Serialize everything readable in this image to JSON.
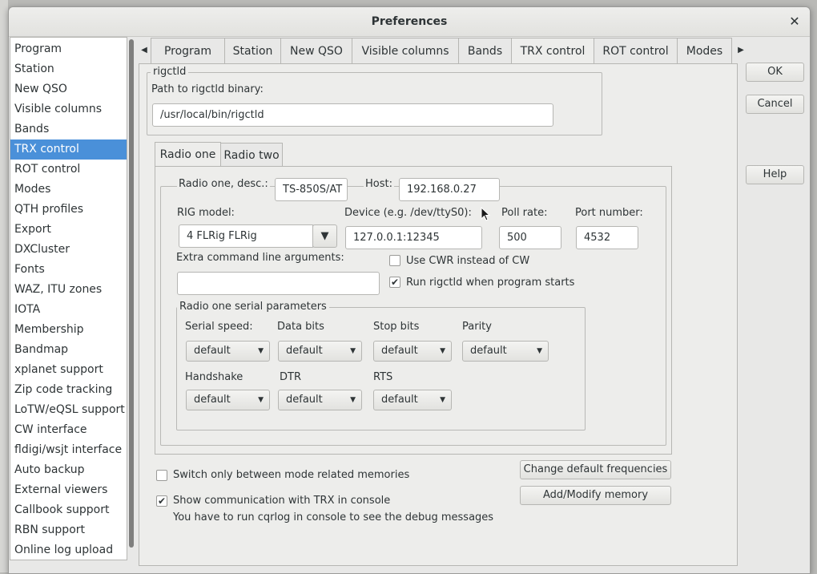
{
  "window": {
    "title": "Preferences"
  },
  "sidebar": {
    "items": [
      {
        "label": "Program"
      },
      {
        "label": "Station"
      },
      {
        "label": "New QSO"
      },
      {
        "label": "Visible columns"
      },
      {
        "label": "Bands"
      },
      {
        "label": "TRX control",
        "selected": true
      },
      {
        "label": "ROT control"
      },
      {
        "label": "Modes"
      },
      {
        "label": "QTH profiles"
      },
      {
        "label": "Export"
      },
      {
        "label": "DXCluster"
      },
      {
        "label": "Fonts"
      },
      {
        "label": "WAZ, ITU zones"
      },
      {
        "label": "IOTA"
      },
      {
        "label": "Membership"
      },
      {
        "label": "Bandmap"
      },
      {
        "label": "xplanet support"
      },
      {
        "label": "Zip code tracking"
      },
      {
        "label": "LoTW/eQSL support"
      },
      {
        "label": "CW interface"
      },
      {
        "label": "fldigi/wsjt interface"
      },
      {
        "label": "Auto backup"
      },
      {
        "label": "External viewers"
      },
      {
        "label": "Callbook support"
      },
      {
        "label": "RBN support"
      },
      {
        "label": "Online log upload"
      }
    ]
  },
  "tabs": [
    {
      "label": "Program"
    },
    {
      "label": "Station"
    },
    {
      "label": "New QSO"
    },
    {
      "label": "Visible columns"
    },
    {
      "label": "Bands"
    },
    {
      "label": "TRX control",
      "active": true
    },
    {
      "label": "ROT control"
    },
    {
      "label": "Modes"
    }
  ],
  "rigctld": {
    "group_label": "rigctld",
    "path_label": "Path to rigctld binary:",
    "path_value": "/usr/local/bin/rigctld"
  },
  "radio_tabs": [
    {
      "label": "Radio one",
      "active": true
    },
    {
      "label": "Radio two"
    }
  ],
  "radio": {
    "desc_label": "Radio one, desc.:",
    "desc_value": "TS-850S/AT",
    "host_label": "Host:",
    "host_value": "192.168.0.27",
    "rig_model_label": "RIG model:",
    "rig_model_value": "4 FLRig FLRig",
    "device_label": "Device (e.g. /dev/ttyS0):",
    "device_value": "127.0.0.1:12345",
    "poll_rate_label": "Poll rate:",
    "poll_rate_value": "500",
    "port_label": "Port number:",
    "port_value": "4532",
    "extra_args_label": "Extra command line arguments:",
    "extra_args_value": "",
    "use_cwr_label": "Use CWR instead of CW",
    "use_cwr_checked": false,
    "run_rigctld_label": "Run rigctld when program starts",
    "run_rigctld_checked": true
  },
  "serial": {
    "group_label": "Radio one serial parameters",
    "speed_label": "Serial speed:",
    "speed_value": "default",
    "databits_label": "Data bits",
    "databits_value": "default",
    "stopbits_label": "Stop bits",
    "stopbits_value": "default",
    "parity_label": "Parity",
    "parity_value": "default",
    "handshake_label": "Handshake",
    "handshake_value": "default",
    "dtr_label": "DTR",
    "dtr_value": "default",
    "rts_label": "RTS",
    "rts_value": "default"
  },
  "bottom": {
    "switch_memories_label": "Switch only between mode related memories",
    "switch_memories_checked": false,
    "show_comm_label": "Show communication with TRX in console",
    "show_comm_checked": true,
    "debug_note": "You have to run cqrlog in console to see the debug messages",
    "change_freq_button": "Change default frequencies",
    "add_memory_button": "Add/Modify memory"
  },
  "buttons": {
    "ok": "OK",
    "cancel": "Cancel",
    "help": "Help"
  },
  "icons": {
    "close": "close-icon",
    "tab_left": "arrow-left-icon",
    "tab_right": "arrow-right-icon",
    "dropdown": "chevron-down-icon",
    "check": "checkmark-icon"
  },
  "colors": {
    "selection": "#4a90d9",
    "background": "#ededeb"
  }
}
